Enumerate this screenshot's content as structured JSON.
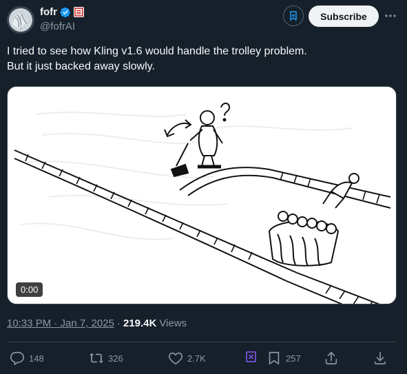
{
  "author": {
    "display_name": "fofr",
    "handle": "@fofrAI"
  },
  "header": {
    "subscribe_label": "Subscribe",
    "more_label": "···"
  },
  "tweet": {
    "text_line1": "I tried to see how Kling v1.6 would handle the trolley problem.",
    "text_line2": "But it just backed away slowly."
  },
  "media": {
    "duration": "0:00"
  },
  "meta": {
    "timestamp": "10:33 PM · Jan 7, 2025",
    "separator": "·",
    "views_count": "219.4K",
    "views_label": "Views"
  },
  "actions": {
    "replies": "148",
    "reposts": "326",
    "likes": "2.7K",
    "bookmarks": "257"
  },
  "colors": {
    "background": "#15202b",
    "verified": "#1d9bf0",
    "affiliate_red": "#c4302b",
    "grok_purple": "#8b5cf6"
  }
}
